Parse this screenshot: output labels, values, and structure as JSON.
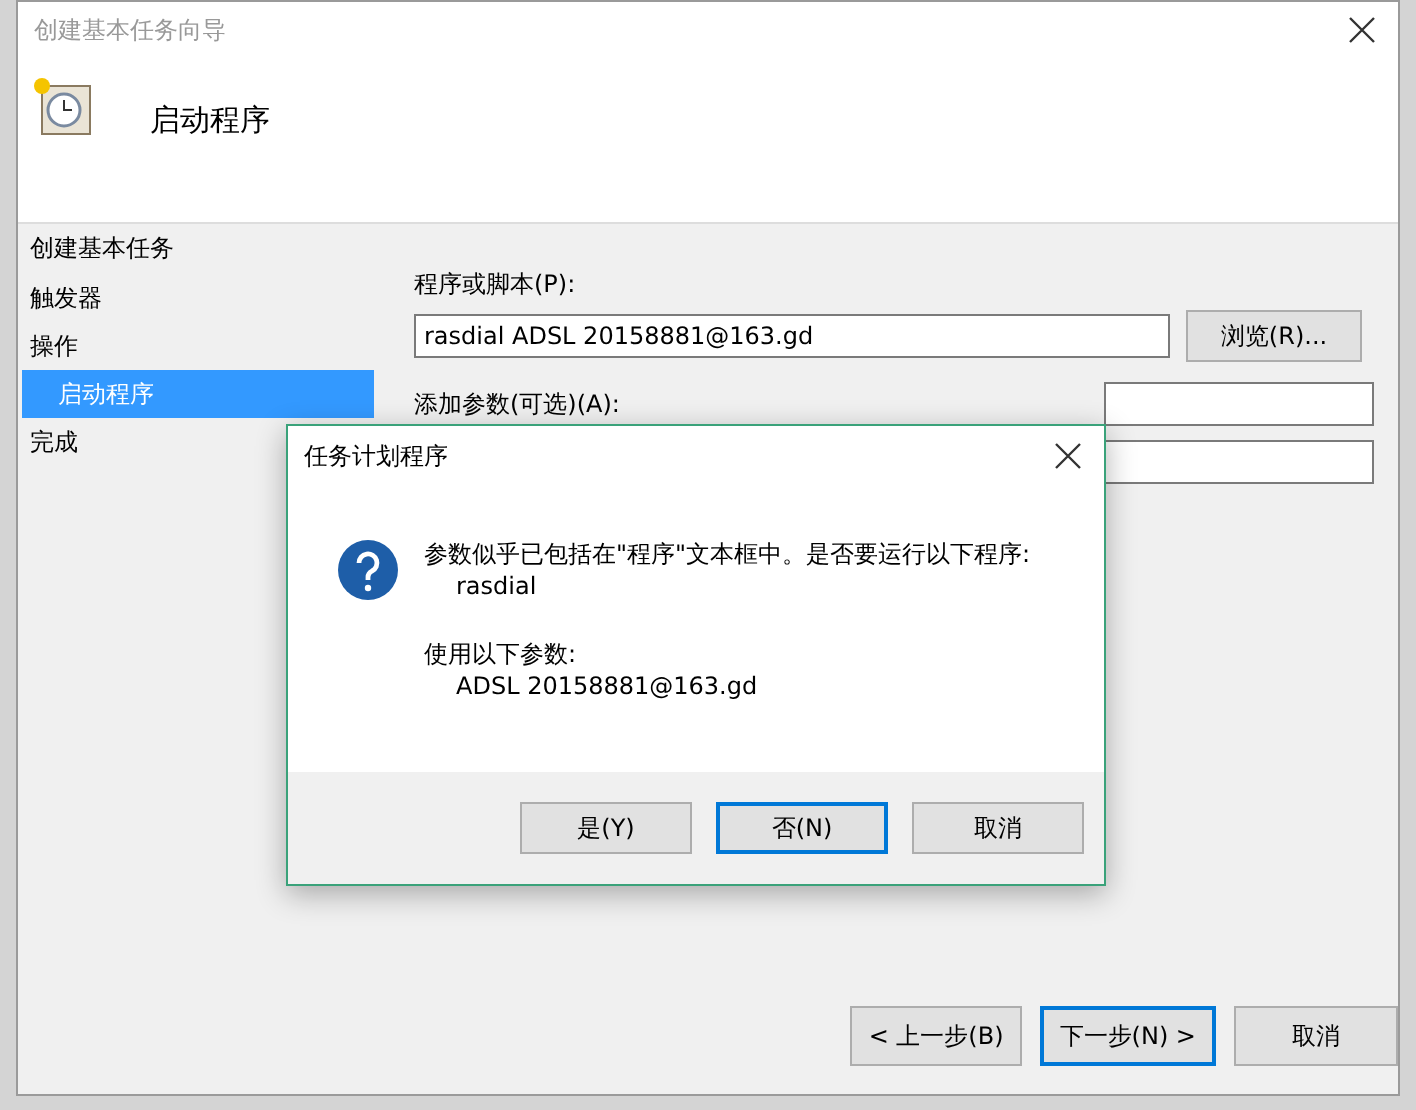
{
  "window": {
    "title": "创建基本任务向导"
  },
  "header": {
    "title": "启动程序"
  },
  "sidebar": {
    "heading": "创建基本任务",
    "items": [
      {
        "label": "触发器",
        "selected": false
      },
      {
        "label": "操作",
        "selected": false,
        "children": [
          {
            "label": "启动程序",
            "selected": true
          }
        ]
      },
      {
        "label": "完成",
        "selected": false
      }
    ]
  },
  "form": {
    "program_label": "程序或脚本(P):",
    "program_value": "rasdial ADSL 20158881@163.gd",
    "browse_button": "浏览(R)...",
    "args_label": "添加参数(可选)(A):"
  },
  "buttons": [
    {
      "label": "< 上一步(B)",
      "focused": false
    },
    {
      "label": "下一步(N) >",
      "focused": true
    },
    {
      "label": "取消",
      "focused": false
    }
  ],
  "dialog": {
    "title": "任务计划程序",
    "message": "参数似乎已包括在\"程序\"文本框中。是否要运行以下程序:",
    "program": "rasdial",
    "args_label": "使用以下参数:",
    "args": "ADSL 20158881@163.gd",
    "buttons": [
      {
        "label": "是(Y)",
        "focused": false
      },
      {
        "label": "否(N)",
        "focused": true
      },
      {
        "label": "取消",
        "focused": false
      }
    ]
  }
}
